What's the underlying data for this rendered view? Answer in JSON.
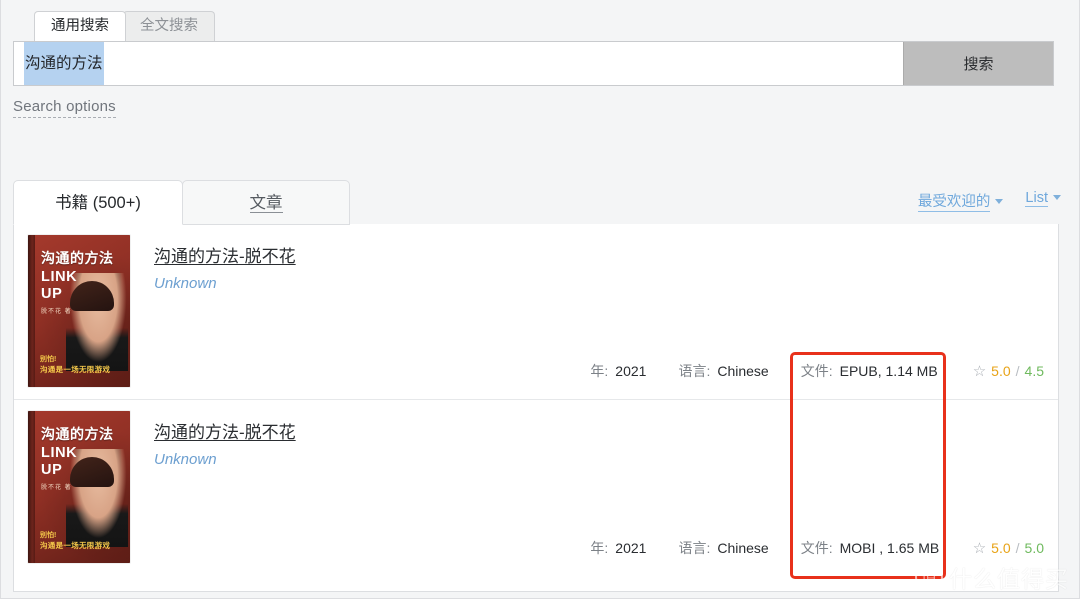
{
  "top_tabs": [
    {
      "label": "通用搜索",
      "active": true
    },
    {
      "label": "全文搜索",
      "active": false
    }
  ],
  "search": {
    "query": "沟通的方法",
    "placeholder": "",
    "button_label": "搜索",
    "options_label": "Search options"
  },
  "results": {
    "tabs": [
      {
        "label": "书籍 (500+)",
        "active": true
      },
      {
        "label": "文章",
        "active": false
      }
    ],
    "controls": {
      "sort_label": "最受欢迎的",
      "view_label": "List"
    },
    "rows": [
      {
        "title": "沟通的方法-脱不花",
        "author": "Unknown",
        "year_key": "年:",
        "year_value": "2021",
        "lang_key": "语言:",
        "lang_value": "Chinese",
        "file_key": "文件:",
        "file_value": "EPUB, 1.14 MB",
        "rating_main": "5.0",
        "rating_sep": "/",
        "rating_quality": "4.5",
        "star_icon": "☆",
        "cover": {
          "title": "沟通的方法",
          "line1": "LINK",
          "line2": "UP",
          "author": "脱不花 著",
          "bottom1": "别怕!",
          "bottom2": "沟通是一场无限游戏"
        }
      },
      {
        "title": "沟通的方法-脱不花",
        "author": "Unknown",
        "year_key": "年:",
        "year_value": "2021",
        "lang_key": "语言:",
        "lang_value": "Chinese",
        "file_key": "文件:",
        "file_value": "MOBI , 1.65 MB",
        "rating_main": "5.0",
        "rating_sep": "/",
        "rating_quality": "5.0",
        "star_icon": "☆",
        "cover": {
          "title": "沟通的方法",
          "line1": "LINK",
          "line2": "UP",
          "author": "脱不花 著",
          "bottom1": "别怕!",
          "bottom2": "沟通是一场无限游戏"
        }
      }
    ]
  },
  "annotation": {
    "color": "#e8311b"
  },
  "watermark": {
    "mark": "值",
    "text": "什么值得买"
  },
  "colors": {
    "page_bg": "#f4f5f6",
    "panel_bg": "#ffffff",
    "link_blue": "#6fa8dc",
    "rating_orange": "#e8a317",
    "rating_green": "#6fba5e",
    "annotation_red": "#e8311b",
    "search_button": "#bdbdbd",
    "selection_blue": "#b5d2f0"
  }
}
